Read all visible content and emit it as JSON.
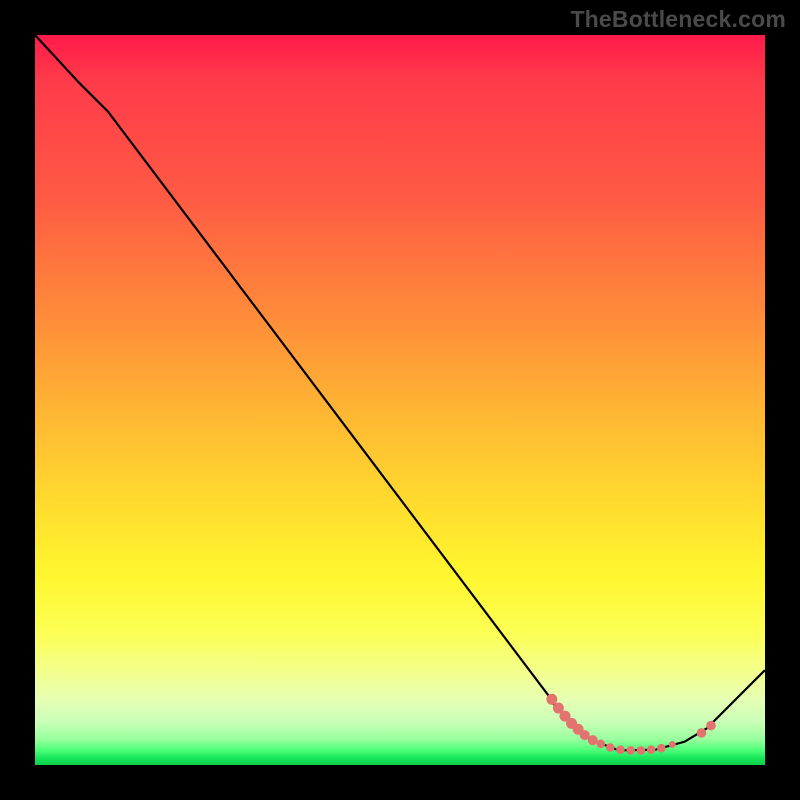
{
  "watermark": "TheBottleneck.com",
  "colors": {
    "curve_stroke": "#000000",
    "marker_fill": "#e2736f",
    "marker_stroke": "#e2736f"
  },
  "chart_data": {
    "type": "line",
    "title": "",
    "xlabel": "",
    "ylabel": "",
    "xlim": [
      0,
      100
    ],
    "ylim": [
      0,
      100
    ],
    "grid": false,
    "curve": [
      {
        "x": 0,
        "y": 100
      },
      {
        "x": 6,
        "y": 93.5
      },
      {
        "x": 10,
        "y": 89.5
      },
      {
        "x": 70.5,
        "y": 9.3
      },
      {
        "x": 71,
        "y": 8.4
      },
      {
        "x": 76,
        "y": 3.5
      },
      {
        "x": 80,
        "y": 2.0
      },
      {
        "x": 85,
        "y": 2.1
      },
      {
        "x": 89,
        "y": 3.2
      },
      {
        "x": 92,
        "y": 5.0
      },
      {
        "x": 100,
        "y": 13.0
      }
    ],
    "markers": [
      {
        "x": 70.8,
        "y": 9.0,
        "r": 5.0
      },
      {
        "x": 71.7,
        "y": 7.8,
        "r": 5.0
      },
      {
        "x": 72.6,
        "y": 6.7,
        "r": 5.0
      },
      {
        "x": 73.5,
        "y": 5.7,
        "r": 5.0
      },
      {
        "x": 74.4,
        "y": 4.9,
        "r": 5.0
      },
      {
        "x": 75.3,
        "y": 4.1,
        "r": 4.5
      },
      {
        "x": 76.4,
        "y": 3.4,
        "r": 4.5
      },
      {
        "x": 77.5,
        "y": 2.9,
        "r": 3.8
      },
      {
        "x": 78.8,
        "y": 2.4,
        "r": 3.8
      },
      {
        "x": 80.2,
        "y": 2.1,
        "r": 3.8
      },
      {
        "x": 81.6,
        "y": 2.0,
        "r": 3.8
      },
      {
        "x": 83.0,
        "y": 2.0,
        "r": 3.8
      },
      {
        "x": 84.4,
        "y": 2.1,
        "r": 3.8
      },
      {
        "x": 85.8,
        "y": 2.3,
        "r": 3.8
      },
      {
        "x": 87.3,
        "y": 2.8,
        "r": 3.0
      },
      {
        "x": 91.3,
        "y": 4.4,
        "r": 4.3
      },
      {
        "x": 92.6,
        "y": 5.4,
        "r": 4.3
      }
    ]
  }
}
